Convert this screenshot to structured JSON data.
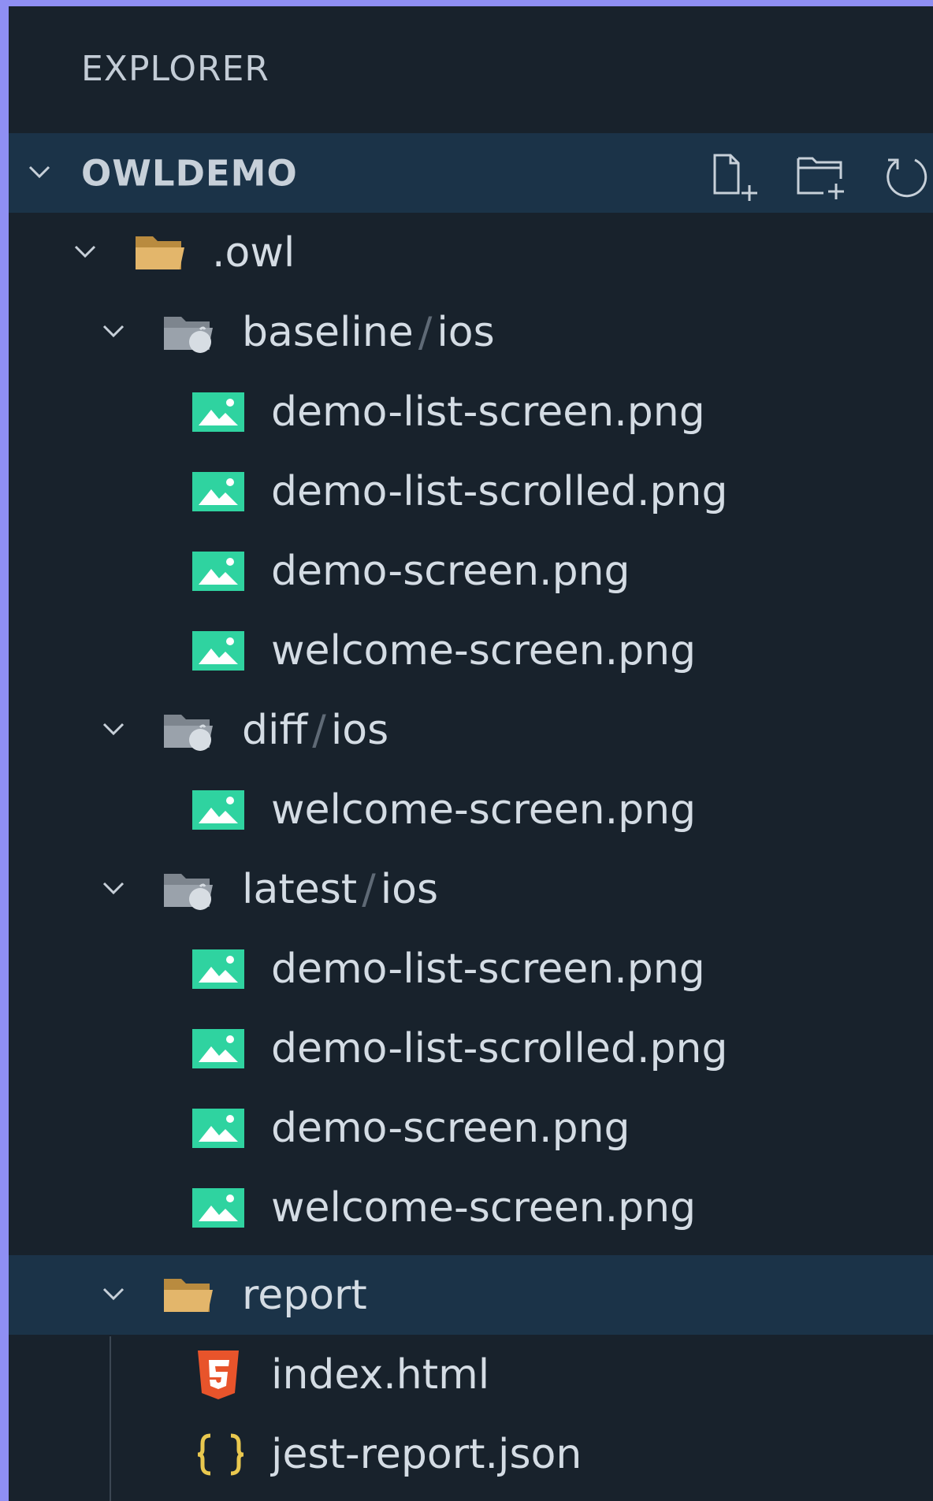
{
  "explorer": {
    "title": "EXPLORER"
  },
  "root": {
    "label": "OWLDEMO",
    "actions": [
      "new-file-icon",
      "new-folder-icon",
      "refresh-icon"
    ]
  },
  "tree": {
    "owl": {
      "label": ".owl"
    },
    "baseline": {
      "prefix": "baseline",
      "separator": "/",
      "suffix": "ios",
      "files": [
        "demo-list-screen.png",
        "demo-list-scrolled.png",
        "demo-screen.png",
        "welcome-screen.png"
      ]
    },
    "diff": {
      "prefix": "diff",
      "separator": "/",
      "suffix": "ios",
      "files": [
        "welcome-screen.png"
      ]
    },
    "latest": {
      "prefix": "latest",
      "separator": "/",
      "suffix": "ios",
      "files": [
        "demo-list-screen.png",
        "demo-list-scrolled.png",
        "demo-screen.png",
        "welcome-screen.png"
      ]
    },
    "report": {
      "label": "report",
      "files": [
        "index.html",
        "jest-report.json"
      ]
    }
  },
  "colors": {
    "background": "#8f8ff3",
    "panel": "#18222c",
    "selected_row": "#1b3348",
    "text": "#d4dce4",
    "image_icon": "#2fd3a0",
    "folder": "#e3b66b",
    "html_icon": "#e8542b",
    "json_icon": "#e9c84f"
  }
}
